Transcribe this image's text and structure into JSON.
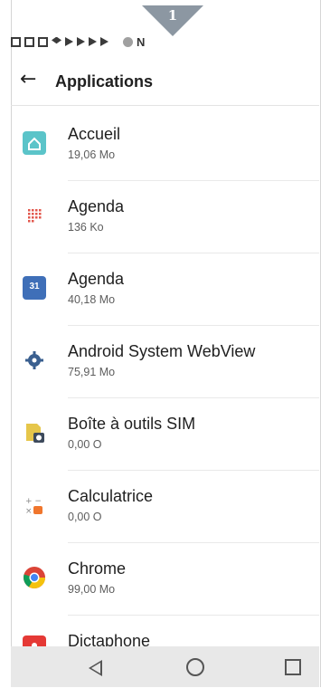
{
  "step_badge": {
    "number": "1"
  },
  "status_bar": {
    "icons": [
      "gmail-icon",
      "calendar-icon",
      "photo-icon",
      "dropbox-icon",
      "play-store-icon",
      "play-store-icon",
      "play-store-icon",
      "play-store-icon",
      "bluetooth-icon",
      "nfc-icon"
    ],
    "nfc_letter": "N"
  },
  "app_bar": {
    "back_icon": "←",
    "title": "Applications"
  },
  "apps": [
    {
      "name": "Accueil",
      "size": "19,06 Mo",
      "icon": "home-icon",
      "color": "#5bc4c9"
    },
    {
      "name": "Agenda",
      "size": "136 Ko",
      "icon": "agenda-dots-icon",
      "color": "#e2574c"
    },
    {
      "name": "Agenda",
      "size": "40,18 Mo",
      "icon": "calendar-31-icon",
      "color": "#3f6fb8",
      "icon_text": "31"
    },
    {
      "name": "Android System WebView",
      "size": "75,91 Mo",
      "icon": "gear-icon",
      "color": "#3a5f8f"
    },
    {
      "name": "Boîte à outils SIM",
      "size": "0,00 O",
      "icon": "sim-toolkit-icon",
      "color": "#e6c64a"
    },
    {
      "name": "Calculatrice",
      "size": "0,00 O",
      "icon": "calculator-icon",
      "color": "#f0762d",
      "icon_text": "+ −\n× ="
    },
    {
      "name": "Chrome",
      "size": "99,00 Mo",
      "icon": "chrome-icon",
      "color": "#db4437"
    },
    {
      "name": "Dictaphone",
      "size": "",
      "icon": "dictaphone-icon",
      "color": "#e53935"
    }
  ],
  "nav_bar": {
    "back_icon": "◁",
    "home_icon": "○",
    "recents_icon": "□"
  }
}
